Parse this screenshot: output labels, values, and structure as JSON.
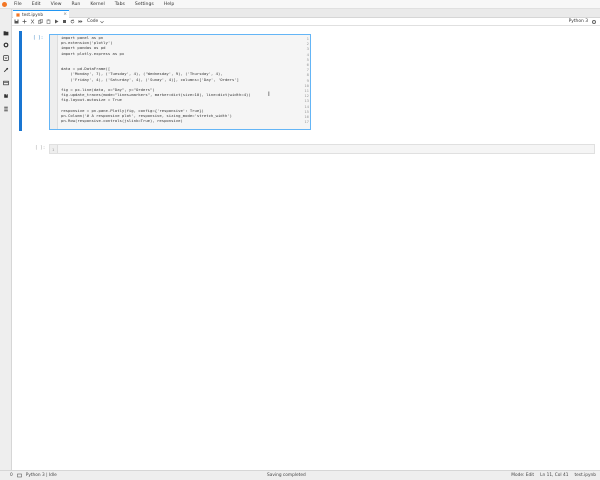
{
  "menubar": {
    "items": [
      "File",
      "Edit",
      "View",
      "Run",
      "Kernel",
      "Tabs",
      "Settings",
      "Help"
    ]
  },
  "tab": {
    "title": "test.ipynb",
    "close": "×"
  },
  "toolbar": {
    "cell_type": "Code",
    "kernel": "Python 3"
  },
  "cell1": {
    "prompt": "[ ]:",
    "lines": [
      {
        "n": "1",
        "t": "import panel as pn"
      },
      {
        "n": "2",
        "t": "pn.extension('plotly')"
      },
      {
        "n": "3",
        "t": "import pandas as pd"
      },
      {
        "n": "4",
        "t": "import plotly.express as px"
      },
      {
        "n": "5",
        "t": ""
      },
      {
        "n": "6",
        "t": ""
      },
      {
        "n": "7",
        "t": "data = pd.DataFrame(["
      },
      {
        "n": "8",
        "t": "    ('Monday', 7), ('Tuesday', 4), ('Wednesday', 9), ('Thursday', 4),"
      },
      {
        "n": "9",
        "t": "    ('Friday', 4), ('Saturday', 4), ('Sunay', 4)], columns=['Day', 'Orders']"
      },
      {
        "n": "10",
        "t": ""
      },
      {
        "n": "11",
        "t": "fig = px.line(data, x=\"Day\", y=\"Orders\")"
      },
      {
        "n": "12",
        "t": "fig.update_traces(mode=\"lines+markers\", marker=dict(size=10), line=dict(width=4))"
      },
      {
        "n": "13",
        "t": "fig.layout.autosize = True"
      },
      {
        "n": "14",
        "t": ""
      },
      {
        "n": "15",
        "t": "responsive = pn.pane.Plotly(fig, config={'responsive': True})"
      },
      {
        "n": "16",
        "t": "pn.Column('# A responsive plot', responsive, sizing_mode='stretch_width')"
      },
      {
        "n": "17",
        "t": "pn.Row(responsive.controls(jslink=True), responsive)"
      }
    ]
  },
  "cell2": {
    "prompt": "[ ]:",
    "line": "1"
  },
  "status": {
    "mode_count": "0",
    "kernel_status": "Python 3 | Idle",
    "message": "Saving completed",
    "mode": "Mode: Edit",
    "position": "Ln 11, Col 41",
    "file": "test.ipynb"
  }
}
